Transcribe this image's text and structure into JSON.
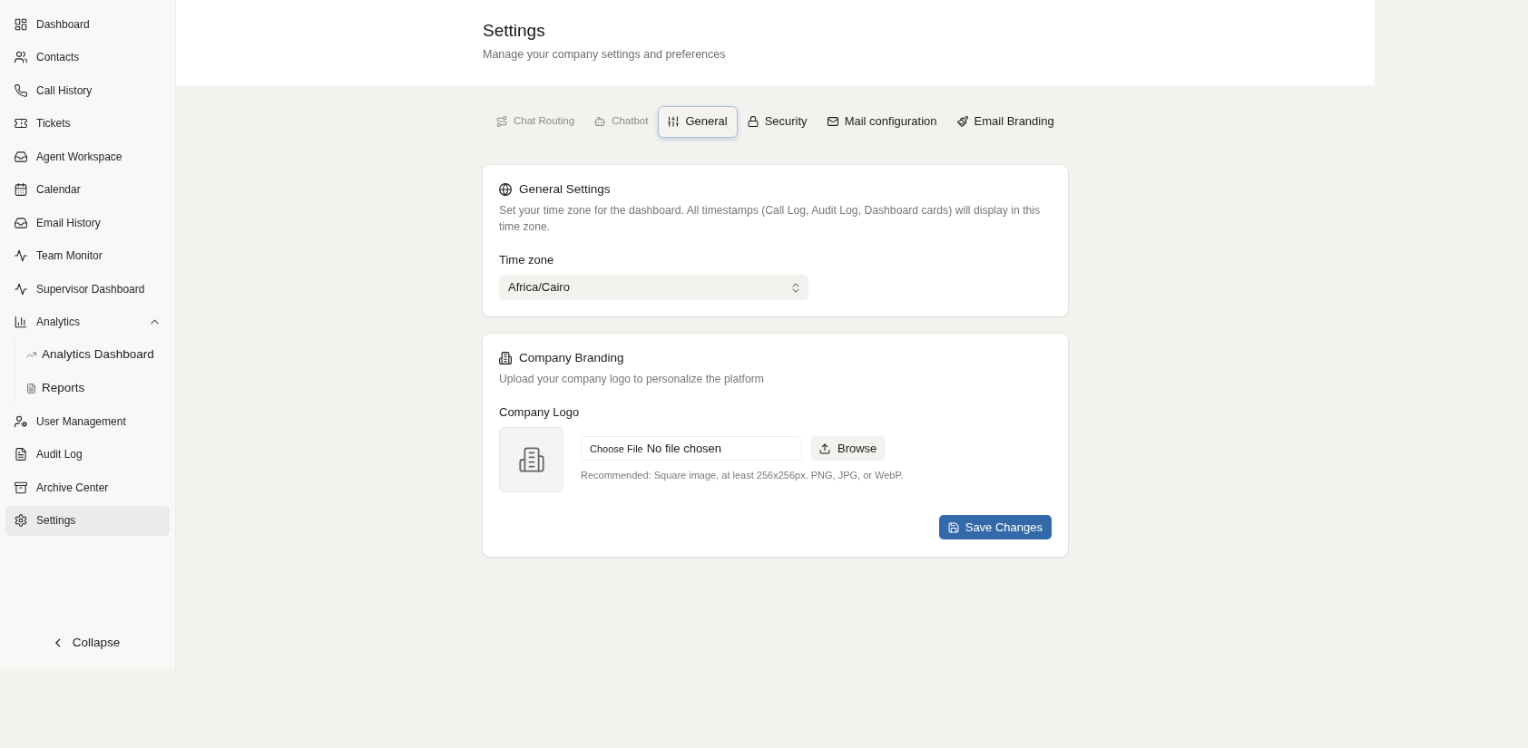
{
  "sidebar": {
    "items": [
      {
        "label": "Dashboard",
        "selected": false
      },
      {
        "label": "Contacts",
        "selected": false
      },
      {
        "label": "Call History",
        "selected": false
      },
      {
        "label": "Tickets",
        "selected": false
      },
      {
        "label": "Agent Workspace",
        "selected": false
      },
      {
        "label": "Calendar",
        "selected": false
      },
      {
        "label": "Email History",
        "selected": false
      },
      {
        "label": "Team Monitor",
        "selected": false
      },
      {
        "label": "Supervisor Dashboard",
        "selected": false
      },
      {
        "label": "Analytics",
        "selected": false,
        "expanded": true,
        "children": [
          {
            "label": "Analytics Dashboard",
            "selected": false
          },
          {
            "label": "Reports",
            "selected": false
          }
        ]
      },
      {
        "label": "User Management",
        "selected": false
      },
      {
        "label": "Audit Log",
        "selected": false
      },
      {
        "label": "Archive Center",
        "selected": false
      },
      {
        "label": "Settings",
        "selected": true
      }
    ],
    "collapse": {
      "label": "Collapse"
    }
  },
  "header": {
    "title": "Settings",
    "subtitle": "Manage your company settings and preferences"
  },
  "tabs": [
    {
      "label": "Chat Routing",
      "selected": false,
      "disabled": true
    },
    {
      "label": "Chatbot",
      "selected": false,
      "disabled": true
    },
    {
      "label": "General",
      "selected": true,
      "disabled": false
    },
    {
      "label": "Security",
      "selected": false,
      "disabled": false
    },
    {
      "label": "Mail configuration",
      "selected": false,
      "disabled": false
    },
    {
      "label": "Email Branding",
      "selected": false,
      "disabled": false
    }
  ],
  "general_settings": {
    "title": "General Settings",
    "description": "Set your time zone for the dashboard. All timestamps (Call Log, Audit Log, Dashboard cards) will display in this time zone.",
    "time_zone": {
      "label": "Time zone",
      "value": "Africa/Cairo"
    }
  },
  "company_branding": {
    "title": "Company Branding",
    "description": "Upload your company logo to personalize the platform",
    "logo": {
      "label": "Company Logo",
      "file_input": {
        "button": "Choose File",
        "status": "No file chosen"
      },
      "browse_button": "Browse",
      "hint": "Recommended: Square image, at least 256x256px. PNG, JPG, or WebP."
    },
    "save_button": "Save Changes"
  }
}
